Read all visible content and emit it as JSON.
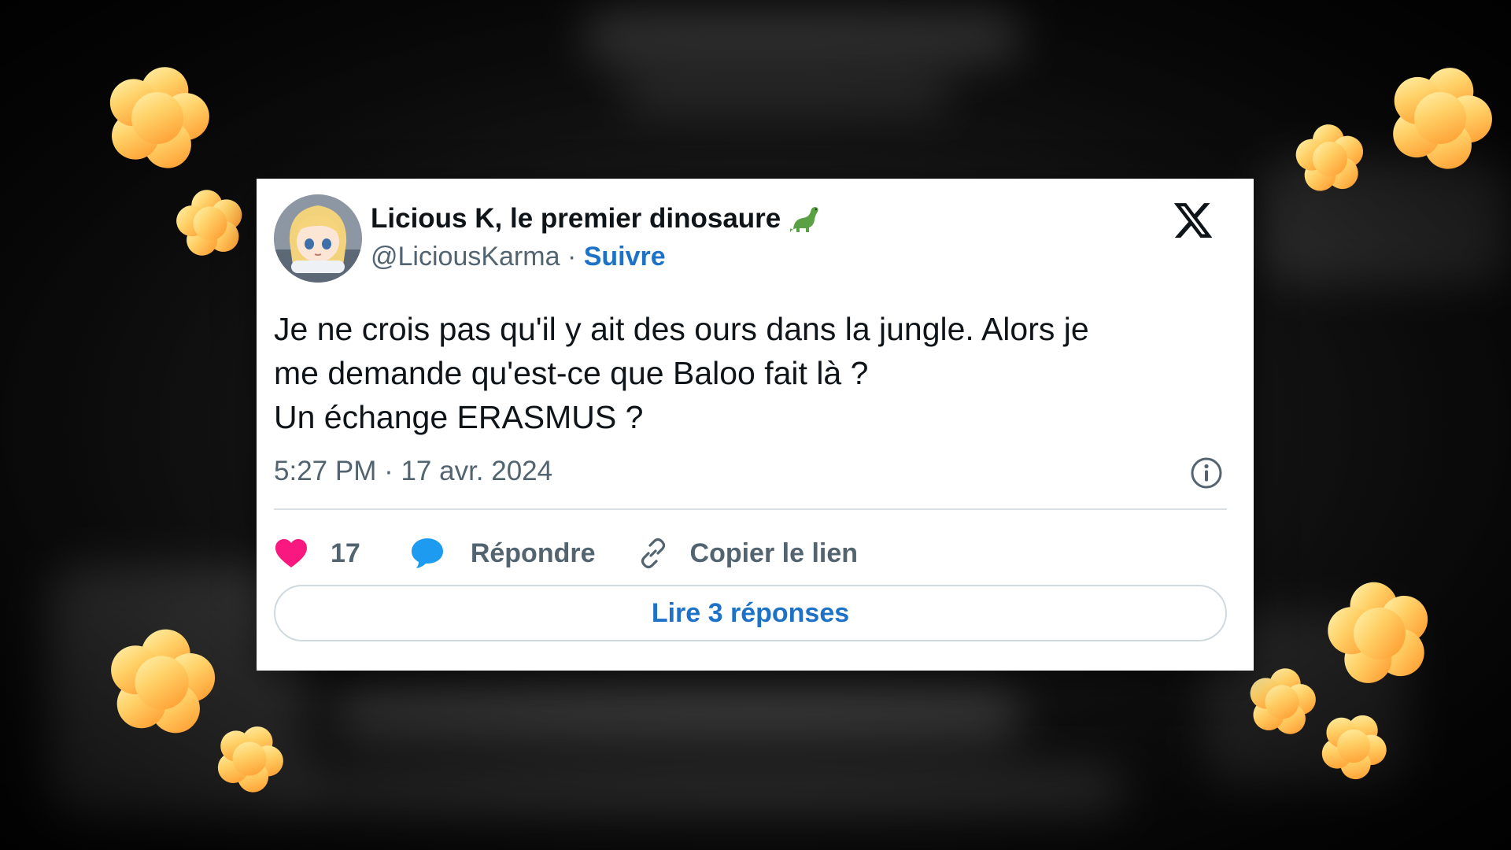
{
  "tweet": {
    "author_name": "Licious K, le premier dinosaure",
    "author_emoji": "dinosaur-emoji",
    "handle": "@LiciousKarma",
    "separator": " · ",
    "follow_label": "Suivre",
    "text_lines": [
      "Je ne crois pas qu'il y ait des ours dans la jungle. Alors je",
      "me demande qu'est-ce que Baloo fait là ?",
      "Un échange ERASMUS ?"
    ],
    "timestamp": "5:27 PM · 17 avr. 2024",
    "actions": {
      "like_count": "17",
      "reply_label": "Répondre",
      "copy_link_label": "Copier le lien"
    },
    "read_replies_label": "Lire 3 réponses"
  },
  "icons": {
    "brand": "x-logo-icon",
    "info": "info-icon",
    "like": "heart-icon",
    "reply": "speech-bubble-icon",
    "copy": "link-icon"
  },
  "colors": {
    "link_blue": "#1d72c8",
    "heart_pink": "#f91880",
    "reply_blue": "#1d9bf0",
    "muted_text": "#536471",
    "flower_yellow": "#ffe066",
    "flower_orange": "#ff9f2e"
  }
}
